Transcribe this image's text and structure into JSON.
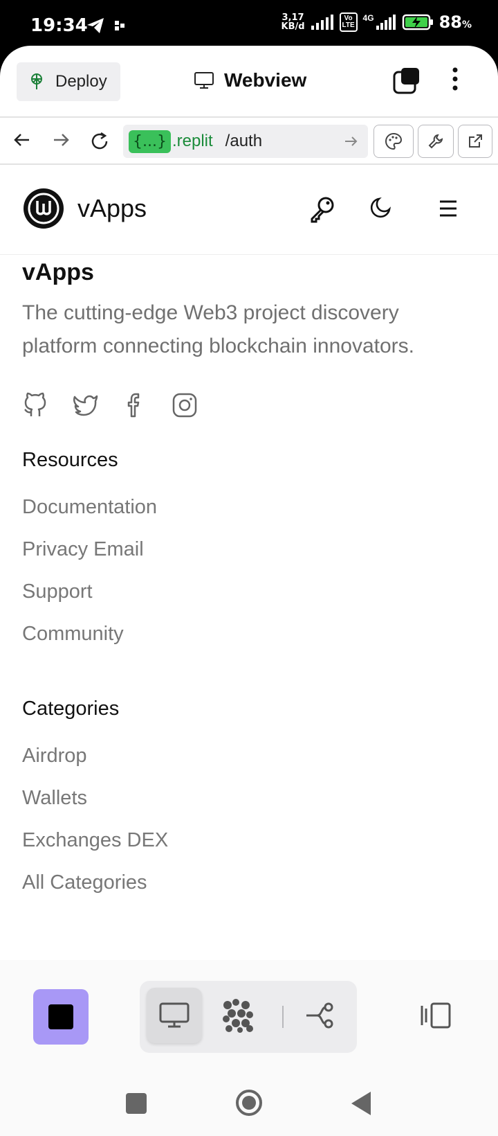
{
  "status": {
    "time": "19:34",
    "speed_top": "3,17",
    "speed_bottom": "KB/d",
    "volte": "Vo LTE",
    "network": "4G",
    "battery": "88",
    "battery_unit": "%"
  },
  "top": {
    "deploy_label": "Deploy",
    "webview_label": "Webview"
  },
  "url": {
    "chip": "{...}",
    "host": ".replit",
    "path": "/auth"
  },
  "site": {
    "name": "vApps",
    "footer_brand": "vApps",
    "description": "The cutting-edge Web3 project discovery platform connecting blockchain innovators.",
    "socials": [
      "github-icon",
      "twitter-icon",
      "facebook-icon",
      "instagram-icon"
    ],
    "resources": {
      "title": "Resources",
      "links": [
        "Documentation",
        "Privacy Email",
        "Support",
        "Community"
      ]
    },
    "categories": {
      "title": "Categories",
      "links": [
        "Airdrop",
        "Wallets",
        "Exchanges DEX",
        "All Categories"
      ]
    }
  },
  "colors": {
    "accent_stop": "#a898f6",
    "url_chip": "#3ac05a",
    "url_host": "#1b8b3a",
    "muted_text": "#707070"
  }
}
